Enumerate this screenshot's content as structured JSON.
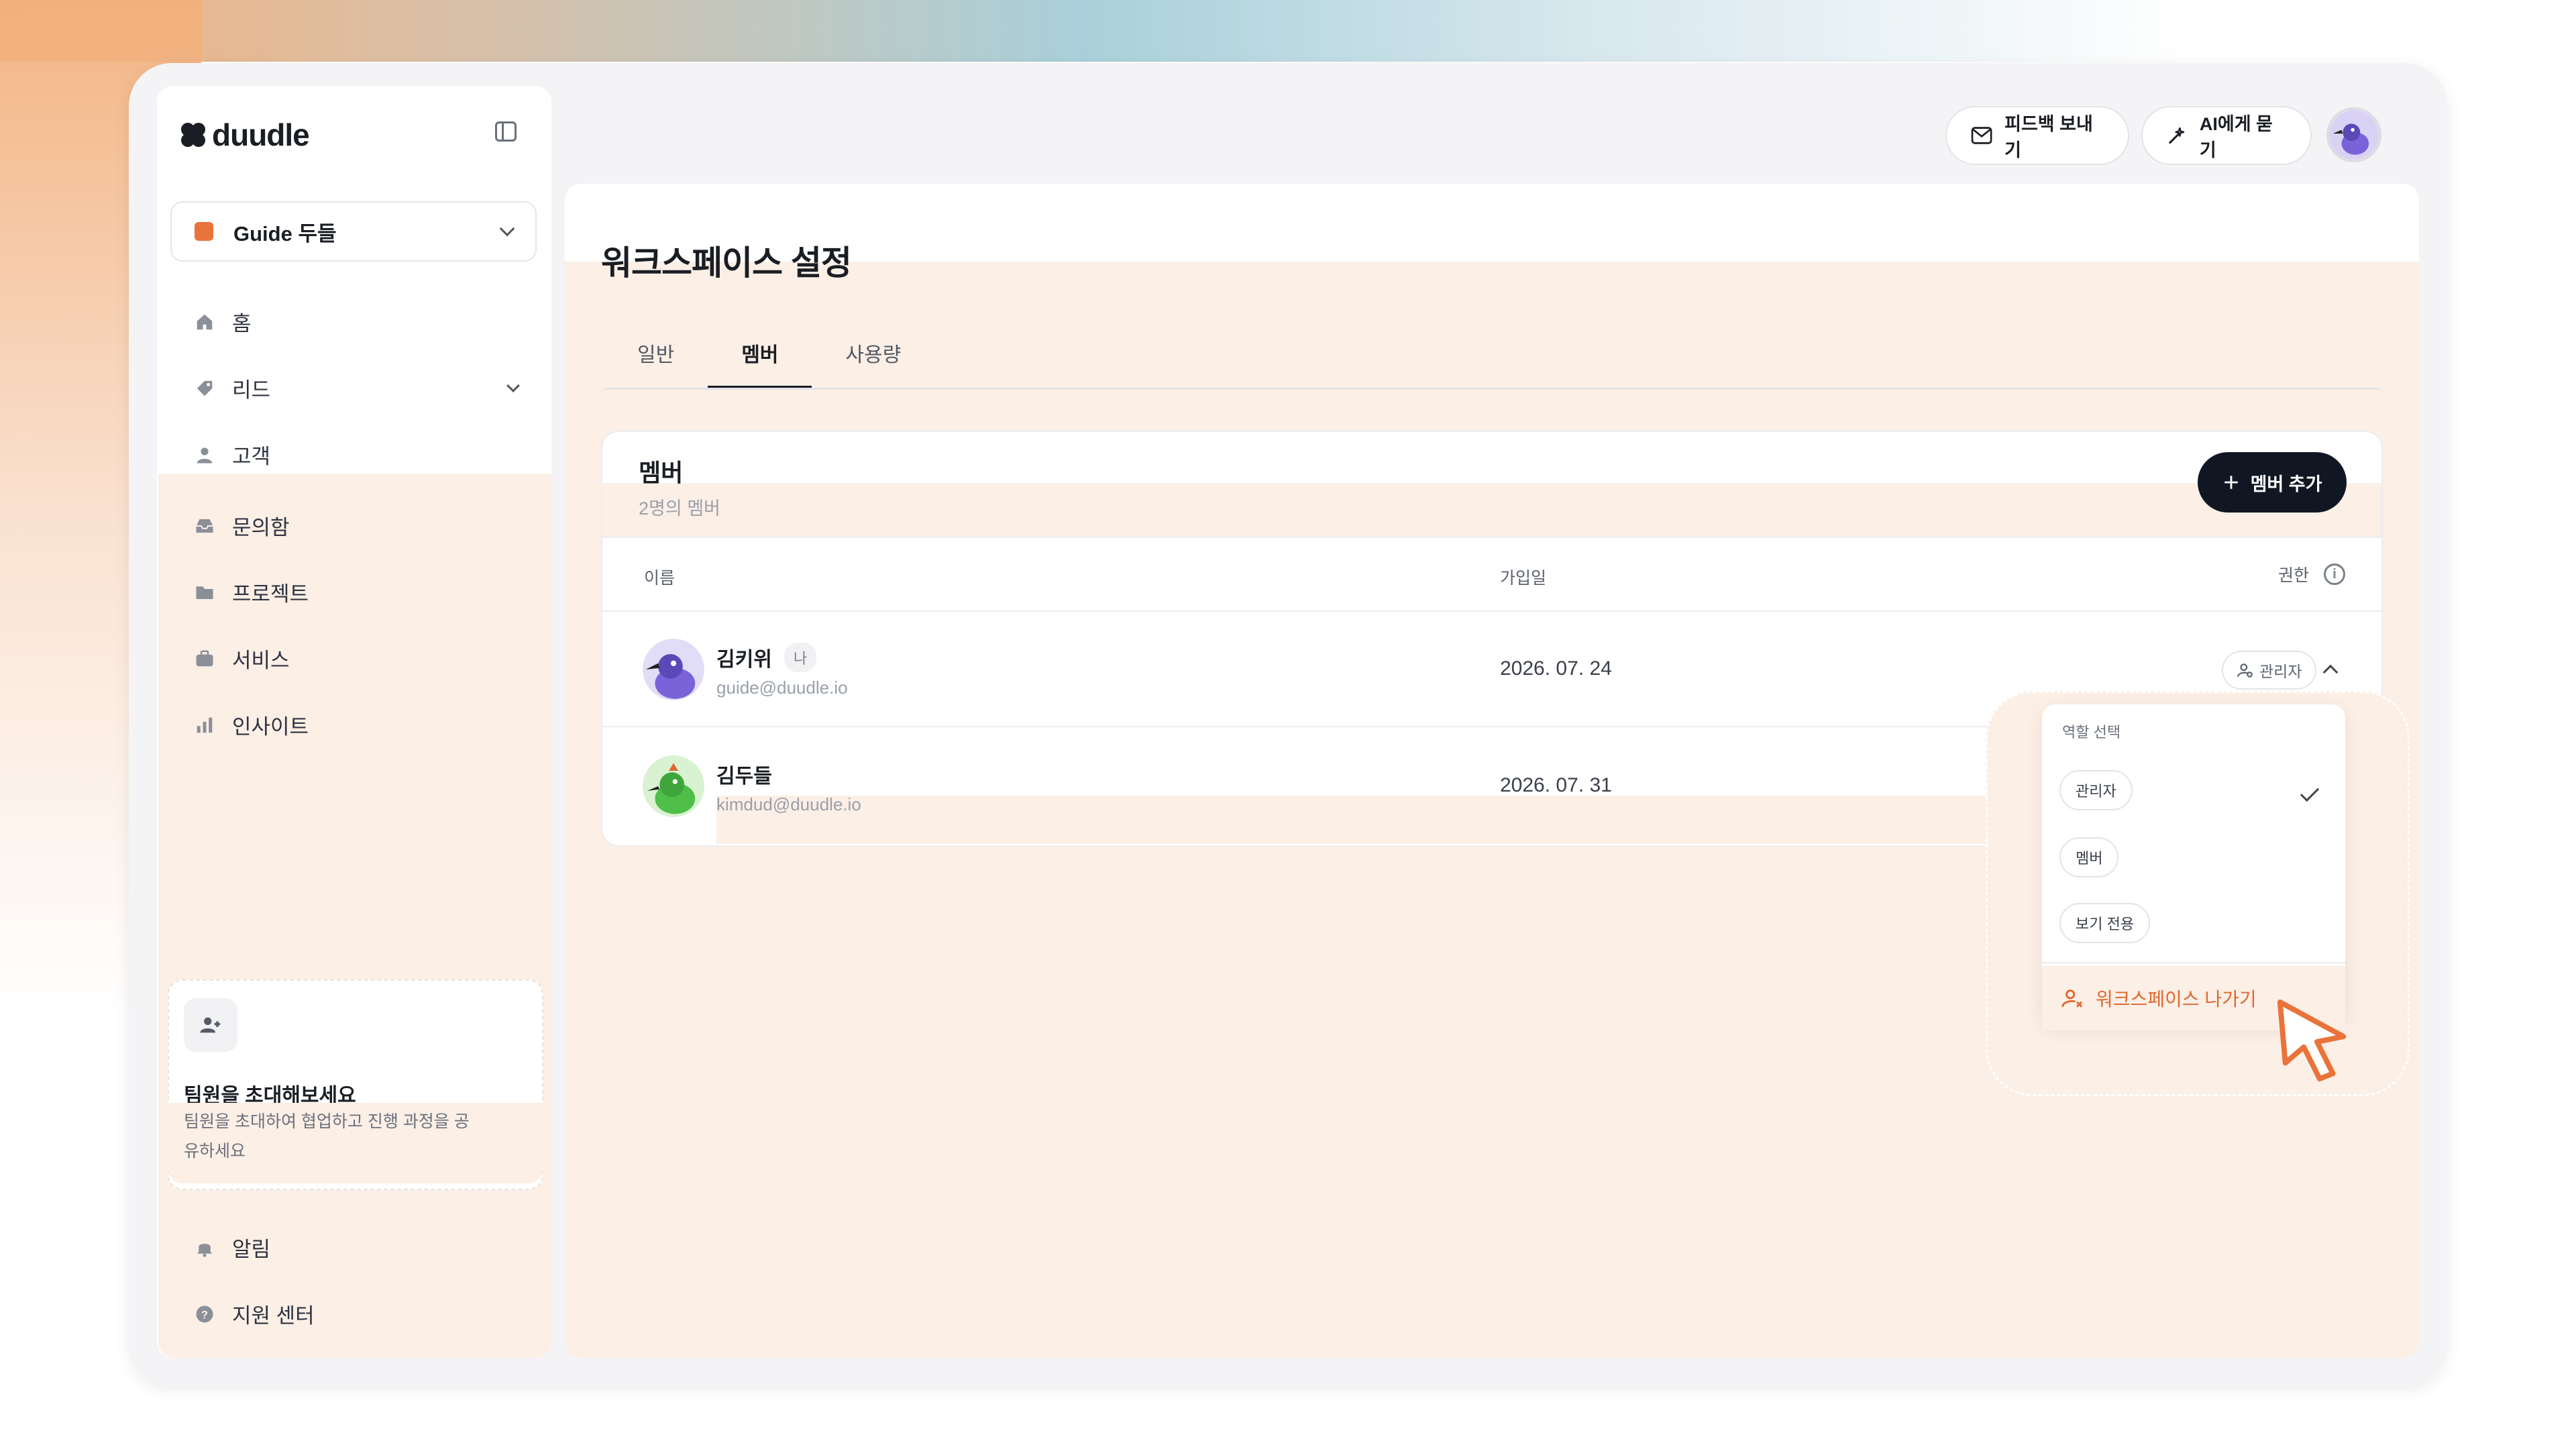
{
  "colors": {
    "accent": "#e9733a",
    "dark_button": "#111722",
    "highlight_tint": "#fbefe6",
    "leave_text": "#e2672e"
  },
  "sidebar": {
    "logo_text": "duudle",
    "workspace_label": "Guide 두들",
    "items": [
      {
        "label": "홈",
        "icon": "home-icon"
      },
      {
        "label": "리드",
        "icon": "tag-icon",
        "expandable": true
      },
      {
        "label": "고객",
        "icon": "person-icon"
      },
      {
        "label": "문의함",
        "icon": "inbox-icon"
      },
      {
        "label": "프로젝트",
        "icon": "folder-icon"
      },
      {
        "label": "서비스",
        "icon": "briefcase-icon"
      },
      {
        "label": "인사이트",
        "icon": "bar-chart-icon"
      }
    ],
    "invite": {
      "title": "팀원을 초대해보세요",
      "description": "팀원을 초대하여 협업하고 진행 과정을 공유하세요"
    },
    "bottom_items": [
      {
        "label": "알림",
        "icon": "bell-icon"
      },
      {
        "label": "지원 센터",
        "icon": "help-icon"
      }
    ]
  },
  "topbar": {
    "feedback_label": "피드백 보내기",
    "ask_ai_label": "AI에게 묻기"
  },
  "page": {
    "title": "워크스페이스 설정",
    "tabs": [
      {
        "label": "일반",
        "active": false
      },
      {
        "label": "멤버",
        "active": true
      },
      {
        "label": "사용량",
        "active": false
      }
    ]
  },
  "members_card": {
    "title": "멤버",
    "subtitle": "2명의 멤버",
    "add_button": "멤버 추가",
    "columns": {
      "name": "이름",
      "joined": "가입일",
      "permission": "권한"
    },
    "rows": [
      {
        "name": "김키위",
        "badge": "나",
        "email": "guide@duudle.io",
        "joined": "2026. 07. 24",
        "role": "관리자"
      },
      {
        "name": "김두들",
        "email": "kimdud@duudle.io",
        "joined": "2026. 07. 31"
      }
    ]
  },
  "role_dropdown": {
    "header": "역할 선택",
    "options": [
      {
        "label": "관리자",
        "selected": true
      },
      {
        "label": "멤버",
        "selected": false
      },
      {
        "label": "보기 전용",
        "selected": false
      }
    ],
    "leave_label": "워크스페이스 나가기"
  }
}
